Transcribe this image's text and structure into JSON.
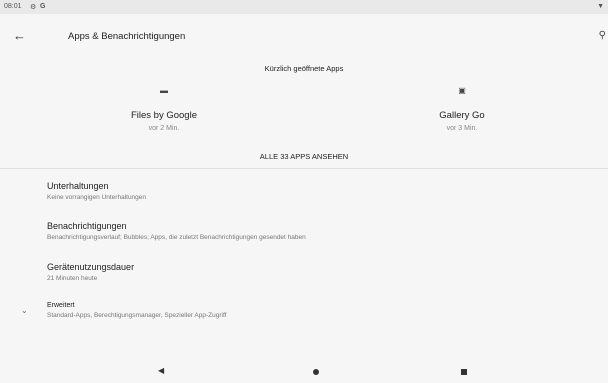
{
  "status_bar": {
    "time": "08:01",
    "icons": [
      "settings-icon",
      "google-icon",
      "wifi-icon"
    ]
  },
  "app_bar": {
    "back_icon": "arrow-left-icon",
    "title": "Apps & Benachrichtigungen",
    "search_icon": "search-icon"
  },
  "recent_apps": {
    "header": "Kürzlich geöffnete Apps",
    "apps": [
      {
        "icon": "files-icon",
        "name": "Files by Google",
        "time": "vor 2 Min."
      },
      {
        "icon": "gallery-icon",
        "name": "Gallery Go",
        "time": "vor 3 Min."
      }
    ],
    "see_all": "ALLE 33 APPS ANSEHEN"
  },
  "settings": [
    {
      "title": "Unterhaltungen",
      "subtitle": "Keine vorrangigen Unterhaltungen"
    },
    {
      "title": "Benachrichtigungen",
      "subtitle": "Benachrichtigungsverlauf; Bubbles; Apps, die zuletzt Benachrichtigungen gesendet haben"
    },
    {
      "title": "Gerätenutzungsdauer",
      "subtitle": "21 Minuten heute"
    },
    {
      "title": "Erweitert",
      "subtitle": "Standard-Apps, Berechtigungsmanager, Spezieller App-Zugriff",
      "icon": "chevron-down-icon"
    }
  ],
  "nav_bar": {
    "icons": [
      "nav-back-icon",
      "nav-home-icon",
      "nav-recents-icon"
    ]
  }
}
